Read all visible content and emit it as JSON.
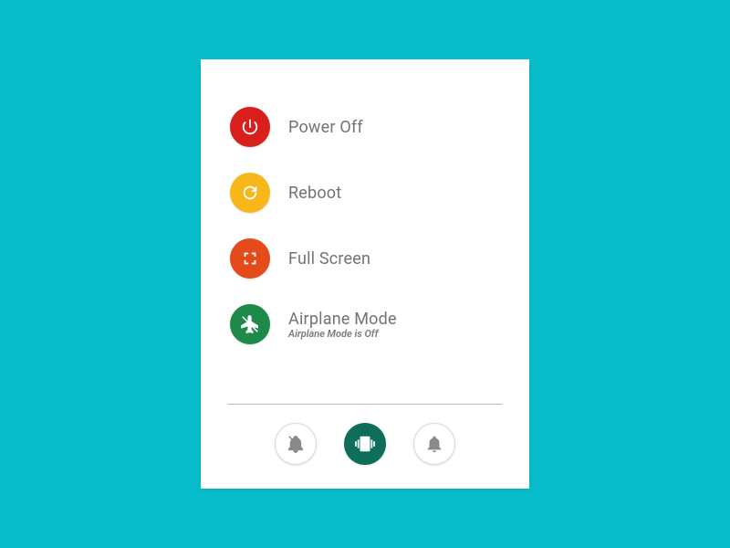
{
  "colors": {
    "power": "#d81f1c",
    "reboot": "#f7b61a",
    "fullscreen": "#e44a1a",
    "airplane": "#1e8a4a",
    "footer_active": "#0f6e5a"
  },
  "menu": {
    "power_off": {
      "label": "Power Off"
    },
    "reboot": {
      "label": "Reboot"
    },
    "fullscreen": {
      "label": "Full Screen"
    },
    "airplane": {
      "label": "Airplane Mode",
      "status": "Airplane Mode is Off"
    }
  },
  "footer": {
    "mute": {
      "name": "mute"
    },
    "vibrate": {
      "name": "vibrate",
      "active": true
    },
    "sound": {
      "name": "sound"
    }
  }
}
